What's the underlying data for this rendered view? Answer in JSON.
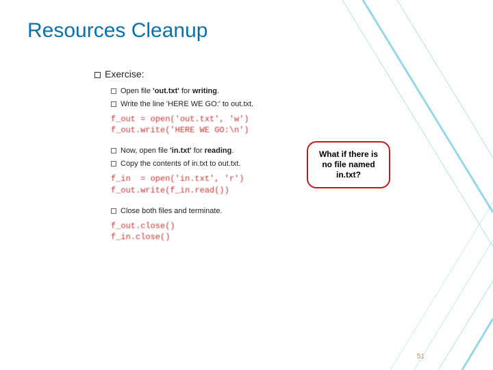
{
  "title": "Resources Cleanup",
  "exercise_label": "Exercise:",
  "items": {
    "a": "Open file 'out.txt' for writing.",
    "b": "Write the line 'HERE WE GO:' to out.txt.",
    "c": "Now, open file 'in.txt' for reading.",
    "d": "Copy the contents of in.txt to out.txt.",
    "e": "Close both files and terminate."
  },
  "code": {
    "block1": "f_out = open('out.txt', 'w')\nf_out.write('HERE WE GO:\\n')",
    "block2": "f_in  = open('in.txt', 'r')\nf_out.write(f_in.read())",
    "block3": "f_out.close()\nf_in.close()"
  },
  "callout": "What if there is no file named in.txt?",
  "page_number": "51"
}
